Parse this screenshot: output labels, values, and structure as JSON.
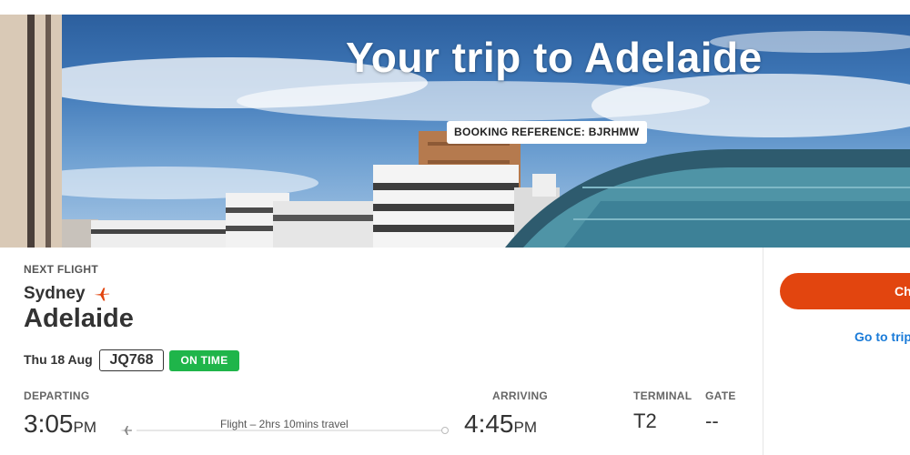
{
  "hero": {
    "title": "Your trip to Adelaide",
    "booking_reference": "BOOKING REFERENCE: BJRHMW"
  },
  "flight": {
    "section_label": "NEXT FLIGHT",
    "origin": "Sydney",
    "destination": "Adelaide",
    "date": "Thu 18 Aug",
    "flight_number": "JQ768",
    "status": "ON TIME",
    "status_color": "#1fb54a",
    "departing_label": "DEPARTING",
    "departing_time": "3:05",
    "departing_ampm": "PM",
    "travel_info": "Flight – 2hrs 10mins travel",
    "arriving_label": "ARRIVING",
    "arriving_time": "4:45",
    "arriving_ampm": "PM",
    "terminal_label": "TERMINAL",
    "terminal_value": "T2",
    "gate_label": "GATE",
    "gate_value": "--"
  },
  "sidebar": {
    "primary_button_label": "Ch",
    "primary_button_color": "#e2450f",
    "trip_link_label": "Go to trip"
  },
  "icons": {
    "origin_plane": "airplane-icon",
    "track_plane": "airplane-icon"
  }
}
